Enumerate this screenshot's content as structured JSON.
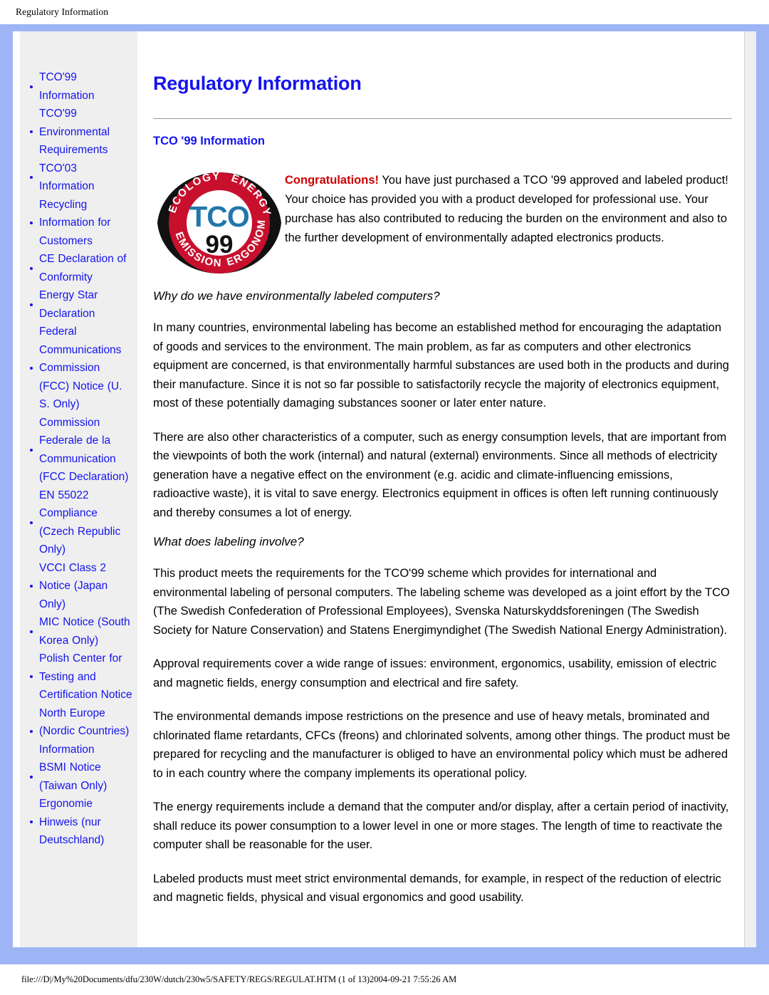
{
  "print_header": {
    "title": "Regulatory Information"
  },
  "sidebar": {
    "items": [
      {
        "label": "TCO'99 Information"
      },
      {
        "label": "TCO'99 Environmental Requirements"
      },
      {
        "label": "TCO'03 Information"
      },
      {
        "label": "Recycling Information for Customers"
      },
      {
        "label": "CE Declaration of Conformity"
      },
      {
        "label": "Energy Star Declaration"
      },
      {
        "label": "Federal Communications Commission (FCC) Notice (U. S. Only)"
      },
      {
        "label": "Commission Federale de la Communication (FCC Declaration)"
      },
      {
        "label": "EN 55022 Compliance (Czech Republic Only)"
      },
      {
        "label": "VCCI Class 2 Notice (Japan Only)"
      },
      {
        "label": "MIC Notice (South Korea Only)"
      },
      {
        "label": "Polish Center for Testing and Certification Notice"
      },
      {
        "label": "North Europe (Nordic Countries) Information"
      },
      {
        "label": "BSMI Notice (Taiwan Only)"
      },
      {
        "label": "Ergonomie Hinweis (nur Deutschland)"
      }
    ]
  },
  "main": {
    "page_title": "Regulatory Information",
    "section_title": "TCO '99 Information",
    "hero": {
      "congrats": "Congratulations!",
      "body": " You have just purchased a TCO '99 approved and labeled product! Your choice has provided you with a product developed for professional use. Your purchase has also contributed to reducing the burden on the environment and also to the further development of environmentally adapted electronics products."
    },
    "subhead_1": "Why do we have environmentally labeled computers?",
    "para_1": "In many countries, environmental labeling has become an established method for encouraging the adaptation of goods and services to the environment. The main problem, as far as computers and other electronics equipment are concerned, is that environmentally harmful substances are used both in the products and during their manufacture. Since it is not so far possible to satisfactorily recycle the majority of electronics equipment, most of these potentially damaging substances sooner or later enter nature.",
    "para_2": "There are also other characteristics of a computer, such as energy consumption levels, that are important from the viewpoints of both the work (internal) and natural (external) environments. Since all methods of electricity generation have a negative effect on the environment (e.g. acidic and climate-influencing emissions, radioactive waste), it is vital to save energy. Electronics equipment in offices is often left running continuously and thereby consumes a lot of energy.",
    "subhead_2": "What does labeling involve?",
    "para_3": "This product meets the requirements for the TCO'99 scheme which provides for international and environmental labeling of personal computers. The labeling scheme was developed as a joint effort by the TCO (The Swedish Confederation of Professional Employees), Svenska Naturskyddsforeningen (The Swedish Society for Nature Conservation) and Statens Energimyndighet (The Swedish National Energy Administration).",
    "para_4": "Approval requirements cover a wide range of issues: environment, ergonomics, usability, emission of electric and magnetic fields, energy consumption and electrical and fire safety.",
    "para_5": "The environmental demands impose restrictions on the presence and use of heavy metals, brominated and chlorinated flame retardants, CFCs (freons) and chlorinated solvents, among other things. The product must be prepared for recycling and the manufacturer is obliged to have an environmental policy which must be adhered to in each country where the company implements its operational policy.",
    "para_6": "The energy requirements include a demand that the computer and/or display, after a certain period of inactivity, shall reduce its power consumption to a lower level in one or more stages. The length of time to reactivate the computer shall be reasonable for the user.",
    "para_7": "Labeled products must meet strict environmental demands, for example, in respect of the reduction of electric and magnetic fields, physical and visual ergonomics and good usability."
  },
  "logo": {
    "name": "tco-99-certification-logo",
    "brand": "TCO",
    "year": "99",
    "ring_top_left": "ECOLOGY",
    "ring_top_right": "ENERGY",
    "ring_bottom_left": "EMISSIONS",
    "ring_bottom_right": "ERGONOMICS",
    "colors": {
      "ring_red": "#c8102e",
      "eye_black": "#111111",
      "brand_blue": "#2277aa",
      "year_black": "#111111"
    }
  },
  "print_footer": {
    "text": "file:///D|/My%20Documents/dfu/230W/dutch/230w5/SAFETY/REGS/REGULAT.HTM (1 of 13)2004-09-21 7:55:26 AM"
  },
  "theme": {
    "frame_blue": "#9db5f5",
    "link_blue": "#1414ee",
    "sidebar_gray": "#efefef",
    "congrats_red": "#cc0000"
  }
}
